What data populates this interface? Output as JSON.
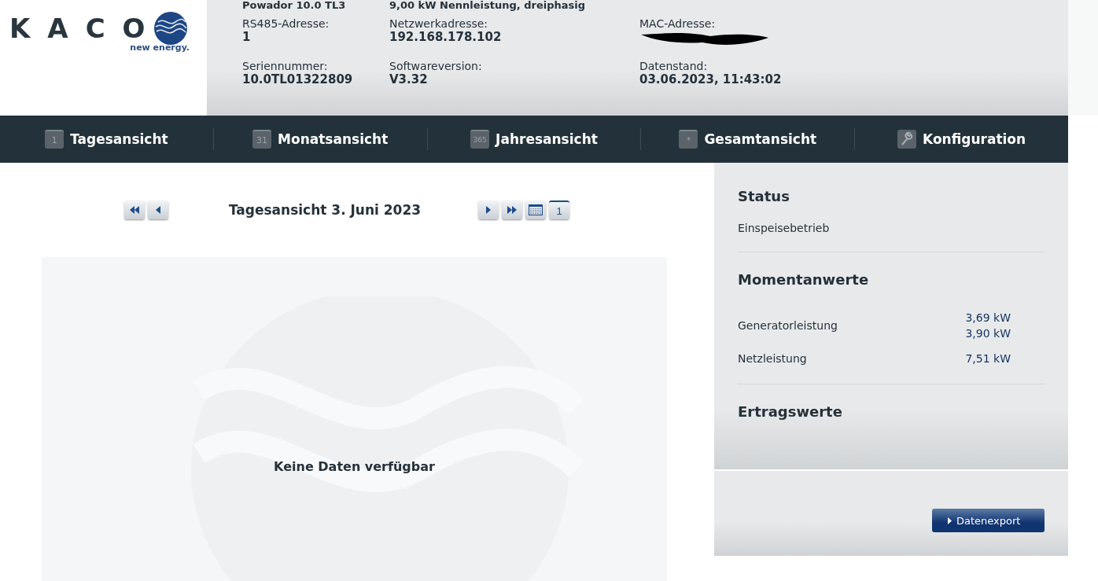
{
  "logo": {
    "wordmark": "KACO",
    "tagline": "new energy."
  },
  "device": {
    "model": "Powador 10.0 TL3",
    "rating": "9,00 kW Nennleistung, dreiphasig"
  },
  "info": [
    {
      "label": "RS485-Adresse:",
      "value": "1",
      "redacted": false
    },
    {
      "label": "Netzwerkadresse:",
      "value": "192.168.178.102",
      "redacted": false
    },
    {
      "label": "MAC-Adresse:",
      "redacted": true
    },
    {
      "label": "Seriennummer:",
      "value": "10.0TL01322809",
      "redacted": false
    },
    {
      "label": "Softwareversion:",
      "value": "V3.32",
      "redacted": false
    },
    {
      "label": "Datenstand:",
      "value": "03.06.2023, 11:43:02",
      "redacted": false
    }
  ],
  "nav": [
    {
      "label": "Tagesansicht",
      "kind": "text",
      "icon_text": "1"
    },
    {
      "label": "Monatsansicht",
      "kind": "text",
      "icon_text": "31"
    },
    {
      "label": "Jahresansicht",
      "kind": "text",
      "icon_text": "365"
    },
    {
      "label": "Gesamtansicht",
      "kind": "text",
      "icon_text": "*"
    },
    {
      "label": "Konfiguration",
      "kind": "wrench"
    }
  ],
  "date_nav": {
    "title": "Tagesansicht 3. Juni 2023",
    "today_text": "1"
  },
  "chart_panel": {
    "message": "Keine Daten verfügbar"
  },
  "sidebar": {
    "status_title": "Status",
    "status": "Einspeisebetrieb",
    "values_title": "Momentanwerte",
    "values": [
      {
        "label": "Generatorleistung",
        "readings": [
          "3,69 kW",
          "3,90 kW"
        ]
      },
      {
        "label": "Netzleistung",
        "readings": [
          "7,51 kW"
        ]
      }
    ],
    "yield_title": "Ertragswerte",
    "export_button": "Datenexport"
  }
}
